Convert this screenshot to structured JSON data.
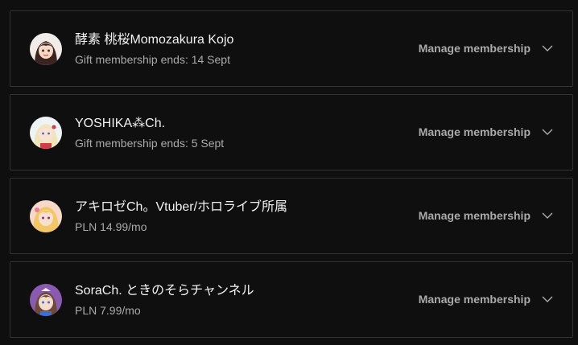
{
  "memberships": [
    {
      "channel_name": "酵素 桃桜Momozakura Kojo",
      "detail": "Gift membership ends: 14 Sept",
      "manage_label": "Manage membership",
      "avatar_icon": "channel-avatar-momozakura",
      "avatar_colors": {
        "bg": "#f2ece8",
        "hair": "#3b2420",
        "skin": "#f4d9c6",
        "accent": "#c0392b"
      }
    },
    {
      "channel_name": "YOSHIKA⁂Ch.",
      "detail": "Gift membership ends: 5 Sept",
      "manage_label": "Manage membership",
      "avatar_icon": "channel-avatar-yoshika",
      "avatar_colors": {
        "bg": "#eef3f5",
        "hair": "#f0e4b8",
        "skin": "#f7e2d4",
        "accent": "#d23a4a"
      }
    },
    {
      "channel_name": "アキロゼCh。Vtuber/ホロライブ所属",
      "detail": "PLN 14.99/mo",
      "manage_label": "Manage membership",
      "avatar_icon": "channel-avatar-akirose",
      "avatar_colors": {
        "bg": "#f7d9c9",
        "hair": "#f3c766",
        "skin": "#f8e0cf",
        "accent": "#e57fa0"
      }
    },
    {
      "channel_name": "SoraCh. ときのそらチャンネル",
      "detail": "PLN 7.99/mo",
      "manage_label": "Manage membership",
      "avatar_icon": "channel-avatar-sora",
      "avatar_colors": {
        "bg": "#8a5ab0",
        "hair": "#6b4a3a",
        "skin": "#f6dcca",
        "accent": "#3a6fd6"
      }
    }
  ],
  "colors": {
    "page_bg": "#0f0f0f",
    "card_border": "#333333",
    "text_primary": "#f1f1f1",
    "text_secondary": "#aaaaaa"
  },
  "icons": {
    "expand": "chevron-down-icon"
  }
}
